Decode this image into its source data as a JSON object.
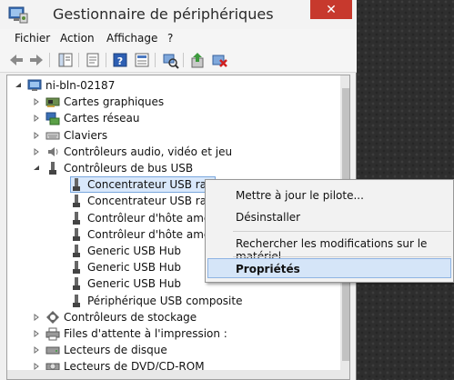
{
  "window": {
    "title": "Gestionnaire de périphériques",
    "close_glyph": "✕"
  },
  "menu": [
    "Fichier",
    "Action",
    "Affichage",
    "?"
  ],
  "tree": {
    "root": "ni-bln-02187",
    "items": [
      {
        "label": "Cartes graphiques",
        "icon": "display-adapter-icon",
        "expander": "collapsed"
      },
      {
        "label": "Cartes réseau",
        "icon": "network-adapter-icon",
        "expander": "collapsed"
      },
      {
        "label": "Claviers",
        "icon": "keyboard-icon",
        "expander": "collapsed"
      },
      {
        "label": "Contrôleurs audio, vidéo et jeu",
        "icon": "speaker-icon",
        "expander": "collapsed"
      },
      {
        "label": "Contrôleurs de bus USB",
        "icon": "usb-icon",
        "expander": "expanded"
      },
      {
        "label": "Concentrateur USB racine",
        "icon": "usb-device-icon",
        "child": true,
        "selected": true
      },
      {
        "label": "Concentrateur USB racine",
        "icon": "usb-device-icon",
        "child": true
      },
      {
        "label": "Contrôleur d'hôte amélior",
        "icon": "usb-device-icon",
        "child": true
      },
      {
        "label": "Contrôleur d'hôte amélior",
        "icon": "usb-device-icon",
        "child": true
      },
      {
        "label": "Generic USB Hub",
        "icon": "usb-device-icon",
        "child": true
      },
      {
        "label": "Generic USB Hub",
        "icon": "usb-device-icon",
        "child": true
      },
      {
        "label": "Generic USB Hub",
        "icon": "usb-device-icon",
        "child": true
      },
      {
        "label": "Périphérique USB composite",
        "icon": "usb-device-icon",
        "child": true
      },
      {
        "label": "Contrôleurs de stockage",
        "icon": "storage-controller-icon",
        "expander": "collapsed"
      },
      {
        "label": "Files d'attente à l'impression :",
        "icon": "printer-icon",
        "expander": "collapsed"
      },
      {
        "label": "Lecteurs de disque",
        "icon": "disk-drive-icon",
        "expander": "collapsed"
      },
      {
        "label": "Lecteurs de DVD/CD-ROM",
        "icon": "dvd-drive-icon",
        "expander": "collapsed"
      }
    ]
  },
  "context_menu": {
    "update_driver": "Mettre à jour le pilote...",
    "uninstall": "Désinstaller",
    "scan_hardware": "Rechercher les modifications sur le matériel",
    "properties": "Propriétés"
  },
  "colors": {
    "close_button": "#c7392d",
    "selection": "#d9e8fb",
    "menu_highlight": "#d5e5f8"
  }
}
